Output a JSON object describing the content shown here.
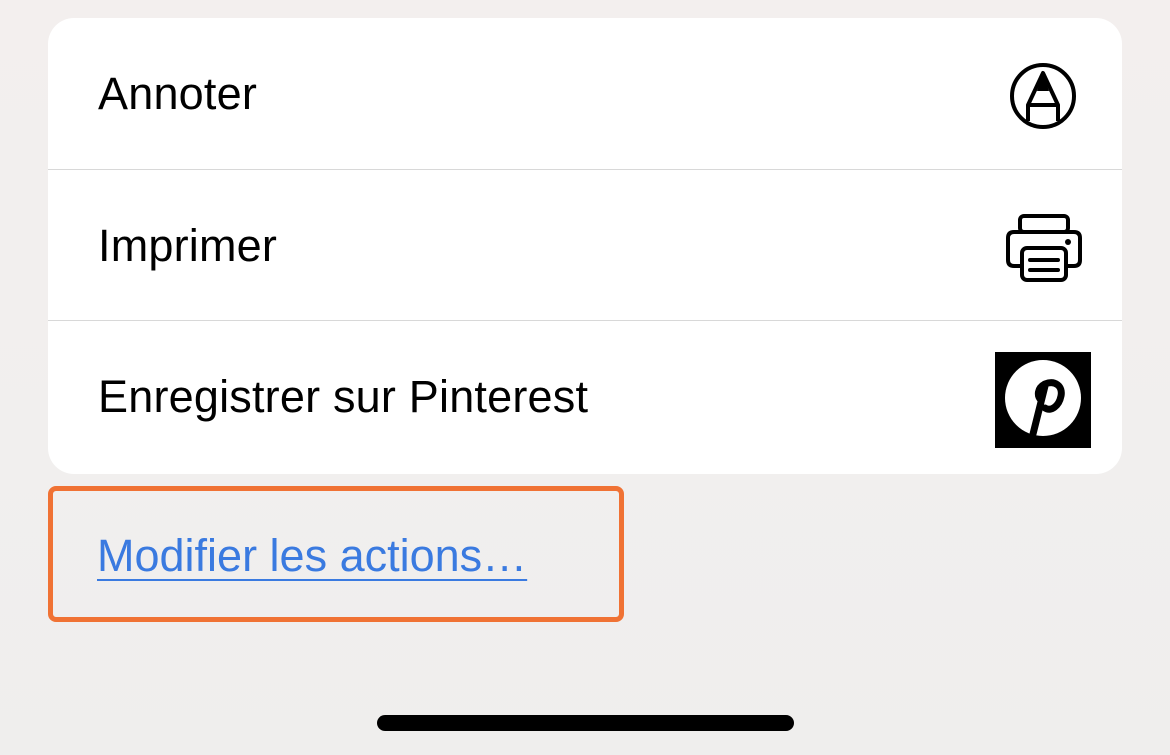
{
  "actions": [
    {
      "label": "Annoter",
      "icon": "markup-pen-icon"
    },
    {
      "label": "Imprimer",
      "icon": "printer-icon"
    },
    {
      "label": "Enregistrer sur Pinterest",
      "icon": "pinterest-logo-icon"
    }
  ],
  "edit_actions": {
    "label": "Modifier les actions…"
  },
  "colors": {
    "link": "#3a7ae0",
    "highlight": "#f07234",
    "card": "#ffffff",
    "separator": "#d8d8d8"
  }
}
